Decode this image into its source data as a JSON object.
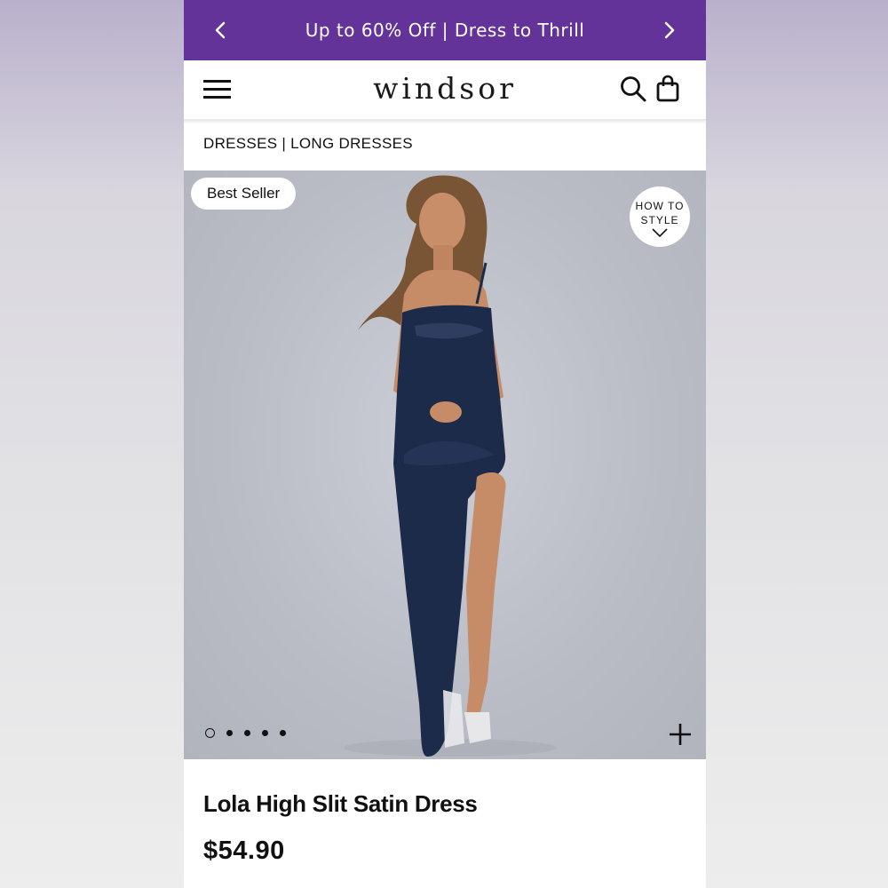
{
  "promo": {
    "text": "Up to 60% Off | Dress to Thrill"
  },
  "header": {
    "logo": "windsor"
  },
  "breadcrumb": {
    "items": [
      "DRESSES",
      "LONG DRESSES"
    ],
    "separator": " | "
  },
  "product": {
    "badge": "Best Seller",
    "how_to_style": [
      "HOW TO",
      "STYLE"
    ],
    "gallery_total": 5,
    "gallery_active": 1,
    "name": "Lola High Slit Satin Dress",
    "price": "$54.90"
  },
  "colors": {
    "promo_bg": "#63339a",
    "dress": "#1d2b4a",
    "photo_bg": "#bfc2cb"
  },
  "icons": [
    "chevron-left-icon",
    "chevron-right-icon",
    "menu-icon",
    "search-icon",
    "bag-icon",
    "chevron-down-icon",
    "plus-icon"
  ]
}
